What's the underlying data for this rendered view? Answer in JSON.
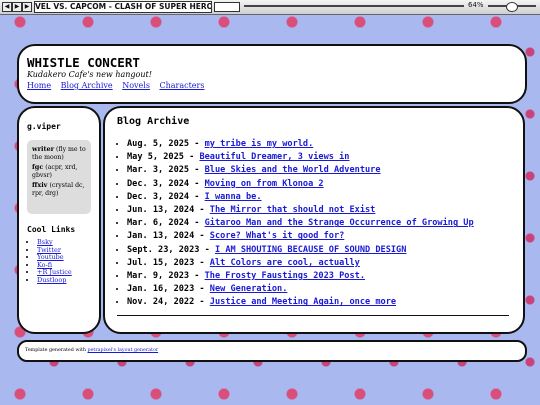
{
  "player": {
    "title": "VEL VS. CAPCOM - CLASH OF SUPER HEROES",
    "volume_label": "64%"
  },
  "header": {
    "title": "WHISTLE CONCERT",
    "tagline": "Kudakero Cafe's new hangout!",
    "nav": [
      "Home",
      "Blog Archive",
      "Novels",
      "Characters"
    ]
  },
  "sidebar": {
    "username": "g.viper",
    "pronouns": [
      {
        "name": "writer",
        "detail": "(fly me to the moon)"
      },
      {
        "name": "fgc",
        "detail": "(acpr, xrd, gbvsr)"
      },
      {
        "name": "ffxiv",
        "detail": "(crystal dc, rpr, drg)"
      }
    ],
    "links_title": "Cool Links",
    "links": [
      "Bsky",
      "Twitter",
      "Youtube",
      "Ko-fi",
      "+R Justice",
      "Dustloop"
    ]
  },
  "main": {
    "title": "Blog Archive",
    "entries": [
      {
        "date": "Aug. 5, 2025 - ",
        "title": "my tribe is my world."
      },
      {
        "date": "May 5, 2025 - ",
        "title": "Beautiful Dreamer, 3 views in"
      },
      {
        "date": "Mar. 3, 2025 - ",
        "title": "Blue Skies and the World Adventure"
      },
      {
        "date": "Dec. 3, 2024 - ",
        "title": "Moving on from Klonoa 2"
      },
      {
        "date": "Dec. 3, 2024 - ",
        "title": "I wanna be."
      },
      {
        "date": "Jun. 13, 2024 - ",
        "title": "The Mirror that should not Exist"
      },
      {
        "date": "Mar. 6, 2024 - ",
        "title": "Gitaroo Man and the Strange Occurrence of Growing Up"
      },
      {
        "date": "Jan. 13, 2024 - ",
        "title": "Score? What's it good for?"
      },
      {
        "date": "Sept. 23, 2023 - ",
        "title": "I AM SHOUTING BECAUSE OF SOUND DESIGN"
      },
      {
        "date": "Jul. 15, 2023 - ",
        "title": "Alt Colors are cool, actually"
      },
      {
        "date": "Mar. 9, 2023 - ",
        "title": "The Frosty Faustings 2023 Post."
      },
      {
        "date": "Jan. 16, 2023 - ",
        "title": "New Generation."
      },
      {
        "date": "Nov. 24, 2022 - ",
        "title": "Justice and Meeting Again, once more"
      }
    ]
  },
  "footer": {
    "text": "Template generated with ",
    "link": "petrapixel's layout generator"
  }
}
